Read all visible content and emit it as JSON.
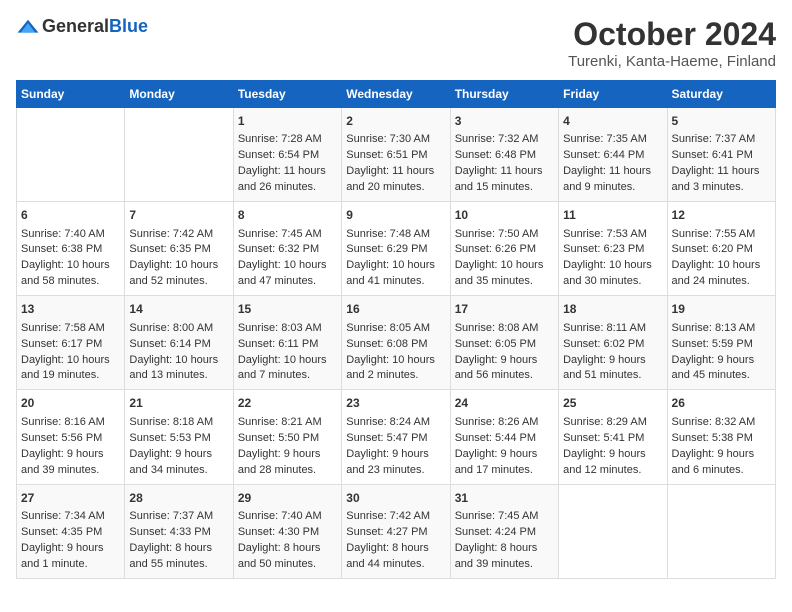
{
  "header": {
    "logo_general": "General",
    "logo_blue": "Blue",
    "month": "October 2024",
    "location": "Turenki, Kanta-Haeme, Finland"
  },
  "days_of_week": [
    "Sunday",
    "Monday",
    "Tuesday",
    "Wednesday",
    "Thursday",
    "Friday",
    "Saturday"
  ],
  "weeks": [
    [
      {
        "day": "",
        "content": ""
      },
      {
        "day": "",
        "content": ""
      },
      {
        "day": "1",
        "sunrise": "Sunrise: 7:28 AM",
        "sunset": "Sunset: 6:54 PM",
        "daylight": "Daylight: 11 hours and 26 minutes."
      },
      {
        "day": "2",
        "sunrise": "Sunrise: 7:30 AM",
        "sunset": "Sunset: 6:51 PM",
        "daylight": "Daylight: 11 hours and 20 minutes."
      },
      {
        "day": "3",
        "sunrise": "Sunrise: 7:32 AM",
        "sunset": "Sunset: 6:48 PM",
        "daylight": "Daylight: 11 hours and 15 minutes."
      },
      {
        "day": "4",
        "sunrise": "Sunrise: 7:35 AM",
        "sunset": "Sunset: 6:44 PM",
        "daylight": "Daylight: 11 hours and 9 minutes."
      },
      {
        "day": "5",
        "sunrise": "Sunrise: 7:37 AM",
        "sunset": "Sunset: 6:41 PM",
        "daylight": "Daylight: 11 hours and 3 minutes."
      }
    ],
    [
      {
        "day": "6",
        "sunrise": "Sunrise: 7:40 AM",
        "sunset": "Sunset: 6:38 PM",
        "daylight": "Daylight: 10 hours and 58 minutes."
      },
      {
        "day": "7",
        "sunrise": "Sunrise: 7:42 AM",
        "sunset": "Sunset: 6:35 PM",
        "daylight": "Daylight: 10 hours and 52 minutes."
      },
      {
        "day": "8",
        "sunrise": "Sunrise: 7:45 AM",
        "sunset": "Sunset: 6:32 PM",
        "daylight": "Daylight: 10 hours and 47 minutes."
      },
      {
        "day": "9",
        "sunrise": "Sunrise: 7:48 AM",
        "sunset": "Sunset: 6:29 PM",
        "daylight": "Daylight: 10 hours and 41 minutes."
      },
      {
        "day": "10",
        "sunrise": "Sunrise: 7:50 AM",
        "sunset": "Sunset: 6:26 PM",
        "daylight": "Daylight: 10 hours and 35 minutes."
      },
      {
        "day": "11",
        "sunrise": "Sunrise: 7:53 AM",
        "sunset": "Sunset: 6:23 PM",
        "daylight": "Daylight: 10 hours and 30 minutes."
      },
      {
        "day": "12",
        "sunrise": "Sunrise: 7:55 AM",
        "sunset": "Sunset: 6:20 PM",
        "daylight": "Daylight: 10 hours and 24 minutes."
      }
    ],
    [
      {
        "day": "13",
        "sunrise": "Sunrise: 7:58 AM",
        "sunset": "Sunset: 6:17 PM",
        "daylight": "Daylight: 10 hours and 19 minutes."
      },
      {
        "day": "14",
        "sunrise": "Sunrise: 8:00 AM",
        "sunset": "Sunset: 6:14 PM",
        "daylight": "Daylight: 10 hours and 13 minutes."
      },
      {
        "day": "15",
        "sunrise": "Sunrise: 8:03 AM",
        "sunset": "Sunset: 6:11 PM",
        "daylight": "Daylight: 10 hours and 7 minutes."
      },
      {
        "day": "16",
        "sunrise": "Sunrise: 8:05 AM",
        "sunset": "Sunset: 6:08 PM",
        "daylight": "Daylight: 10 hours and 2 minutes."
      },
      {
        "day": "17",
        "sunrise": "Sunrise: 8:08 AM",
        "sunset": "Sunset: 6:05 PM",
        "daylight": "Daylight: 9 hours and 56 minutes."
      },
      {
        "day": "18",
        "sunrise": "Sunrise: 8:11 AM",
        "sunset": "Sunset: 6:02 PM",
        "daylight": "Daylight: 9 hours and 51 minutes."
      },
      {
        "day": "19",
        "sunrise": "Sunrise: 8:13 AM",
        "sunset": "Sunset: 5:59 PM",
        "daylight": "Daylight: 9 hours and 45 minutes."
      }
    ],
    [
      {
        "day": "20",
        "sunrise": "Sunrise: 8:16 AM",
        "sunset": "Sunset: 5:56 PM",
        "daylight": "Daylight: 9 hours and 39 minutes."
      },
      {
        "day": "21",
        "sunrise": "Sunrise: 8:18 AM",
        "sunset": "Sunset: 5:53 PM",
        "daylight": "Daylight: 9 hours and 34 minutes."
      },
      {
        "day": "22",
        "sunrise": "Sunrise: 8:21 AM",
        "sunset": "Sunset: 5:50 PM",
        "daylight": "Daylight: 9 hours and 28 minutes."
      },
      {
        "day": "23",
        "sunrise": "Sunrise: 8:24 AM",
        "sunset": "Sunset: 5:47 PM",
        "daylight": "Daylight: 9 hours and 23 minutes."
      },
      {
        "day": "24",
        "sunrise": "Sunrise: 8:26 AM",
        "sunset": "Sunset: 5:44 PM",
        "daylight": "Daylight: 9 hours and 17 minutes."
      },
      {
        "day": "25",
        "sunrise": "Sunrise: 8:29 AM",
        "sunset": "Sunset: 5:41 PM",
        "daylight": "Daylight: 9 hours and 12 minutes."
      },
      {
        "day": "26",
        "sunrise": "Sunrise: 8:32 AM",
        "sunset": "Sunset: 5:38 PM",
        "daylight": "Daylight: 9 hours and 6 minutes."
      }
    ],
    [
      {
        "day": "27",
        "sunrise": "Sunrise: 7:34 AM",
        "sunset": "Sunset: 4:35 PM",
        "daylight": "Daylight: 9 hours and 1 minute."
      },
      {
        "day": "28",
        "sunrise": "Sunrise: 7:37 AM",
        "sunset": "Sunset: 4:33 PM",
        "daylight": "Daylight: 8 hours and 55 minutes."
      },
      {
        "day": "29",
        "sunrise": "Sunrise: 7:40 AM",
        "sunset": "Sunset: 4:30 PM",
        "daylight": "Daylight: 8 hours and 50 minutes."
      },
      {
        "day": "30",
        "sunrise": "Sunrise: 7:42 AM",
        "sunset": "Sunset: 4:27 PM",
        "daylight": "Daylight: 8 hours and 44 minutes."
      },
      {
        "day": "31",
        "sunrise": "Sunrise: 7:45 AM",
        "sunset": "Sunset: 4:24 PM",
        "daylight": "Daylight: 8 hours and 39 minutes."
      },
      {
        "day": "",
        "content": ""
      },
      {
        "day": "",
        "content": ""
      }
    ]
  ]
}
